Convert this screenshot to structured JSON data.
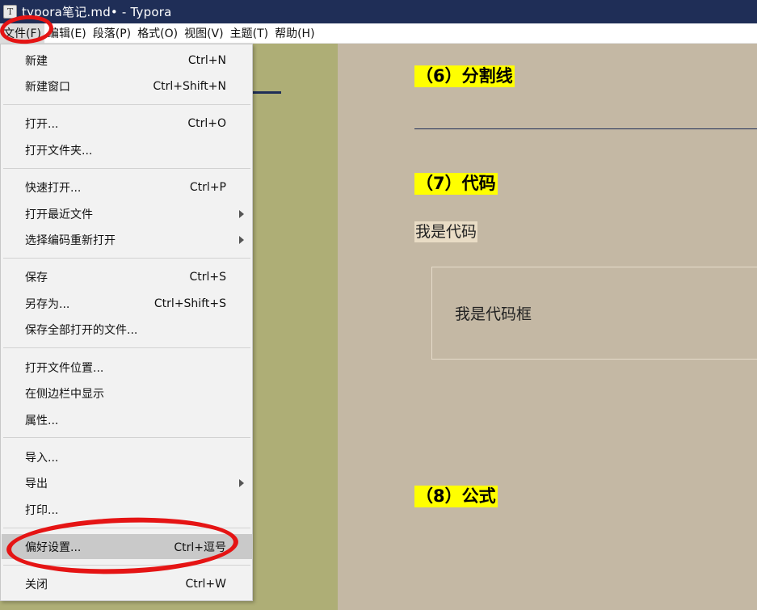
{
  "window": {
    "title": "typora笔记.md• - Typora",
    "app_icon": "T"
  },
  "menubar": [
    {
      "label": "文件(F)"
    },
    {
      "label": "编辑(E)"
    },
    {
      "label": "段落(P)"
    },
    {
      "label": "格式(O)"
    },
    {
      "label": "视图(V)"
    },
    {
      "label": "主题(T)"
    },
    {
      "label": "帮助(H)"
    }
  ],
  "file_menu": {
    "items": [
      {
        "label": "新建",
        "shortcut": "Ctrl+N"
      },
      {
        "label": "新建窗口",
        "shortcut": "Ctrl+Shift+N"
      },
      {
        "label": "打开...",
        "shortcut": "Ctrl+O"
      },
      {
        "label": "打开文件夹..."
      },
      {
        "label": "快速打开...",
        "shortcut": "Ctrl+P"
      },
      {
        "label": "打开最近文件"
      },
      {
        "label": "选择编码重新打开"
      },
      {
        "label": "保存",
        "shortcut": "Ctrl+S"
      },
      {
        "label": "另存为...",
        "shortcut": "Ctrl+Shift+S"
      },
      {
        "label": "保存全部打开的文件..."
      },
      {
        "label": "打开文件位置..."
      },
      {
        "label": "在侧边栏中显示"
      },
      {
        "label": "属性..."
      },
      {
        "label": "导入..."
      },
      {
        "label": "导出"
      },
      {
        "label": "打印..."
      },
      {
        "label": "偏好设置...",
        "shortcut": "Ctrl+逗号"
      },
      {
        "label": "关闭",
        "shortcut": "Ctrl+W"
      }
    ]
  },
  "editor": {
    "heading6": "（6）分割线",
    "heading7": "（7）代码",
    "inline_code": "我是代码",
    "code_block": "我是代码框",
    "heading8": "（8）公式"
  },
  "colors": {
    "titlebar": "#1f2e57",
    "sidebar": "#aeae76",
    "editor_bg": "#c4b8a4",
    "heading_highlight": "#ffff00",
    "annotation_red": "#e51414",
    "menu_highlight": "#c9c9c9"
  }
}
